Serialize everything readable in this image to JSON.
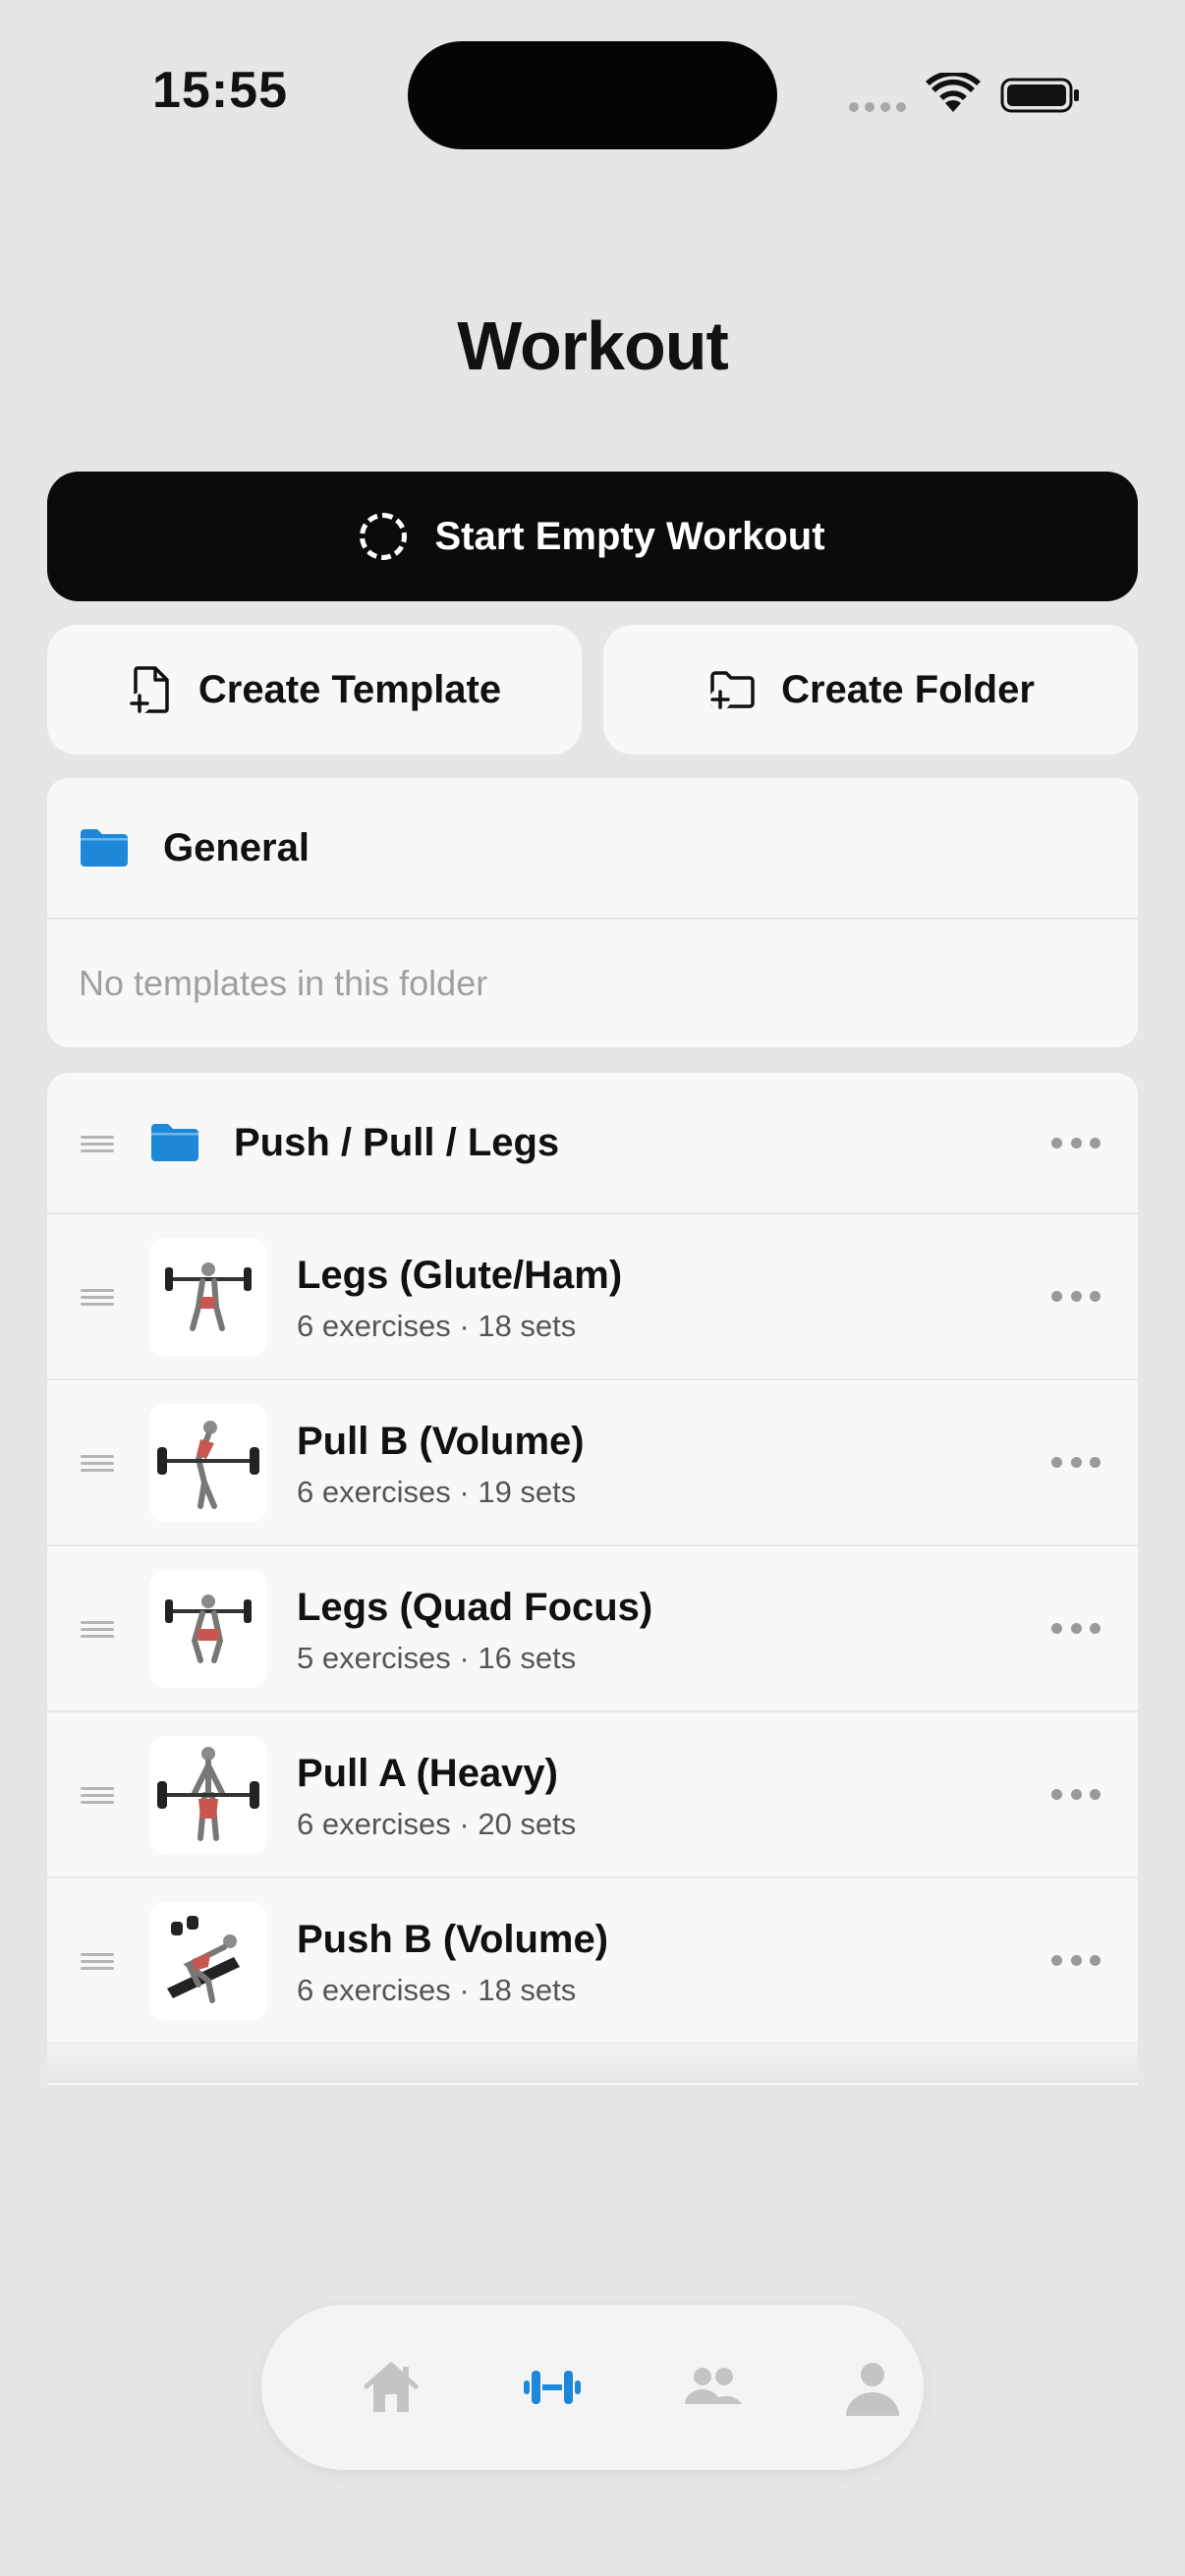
{
  "status_bar": {
    "time": "15:55",
    "icons": [
      "cellular-signal-icon",
      "wifi-icon",
      "battery-icon"
    ]
  },
  "header": {
    "title": "Workout"
  },
  "actions": {
    "start_empty": "Start Empty Workout",
    "create_template": "Create Template",
    "create_folder": "Create Folder"
  },
  "folders": [
    {
      "name": "General",
      "empty_text": "No templates in this folder",
      "icon": "folder-icon",
      "color": "#1e88d8"
    },
    {
      "name": "Push / Pull / Legs",
      "icon": "folder-icon",
      "color": "#1e88d8",
      "templates": [
        {
          "name": "Legs (Glute/Ham)",
          "meta": "6 exercises · 18 sets"
        },
        {
          "name": "Pull B (Volume)",
          "meta": "6 exercises · 19 sets"
        },
        {
          "name": "Legs (Quad Focus)",
          "meta": "5 exercises · 16 sets"
        },
        {
          "name": "Pull A (Heavy)",
          "meta": "6 exercises · 20 sets"
        },
        {
          "name": "Push B (Volume)",
          "meta": "6 exercises · 18 sets"
        }
      ]
    }
  ],
  "tabbar": {
    "items": [
      "home-icon",
      "dumbbell-icon",
      "community-icon",
      "profile-icon"
    ],
    "active": "dumbbell-icon",
    "active_color": "#1e88d8",
    "inactive_color": "#c4c4c4"
  }
}
